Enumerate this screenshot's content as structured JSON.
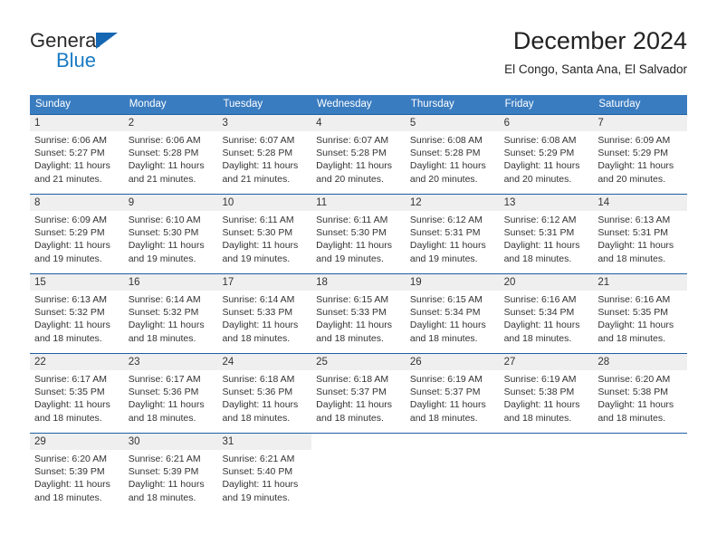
{
  "logo": {
    "word_one": "General",
    "word_two": "Blue",
    "triangle_icon": "blue-triangle-icon",
    "accent_color": "#1a7bc4"
  },
  "header": {
    "title": "December 2024",
    "subtitle": "El Congo, Santa Ana, El Salvador"
  },
  "colors": {
    "header_row": "#3a7cc0",
    "week_divider": "#1e5fa3",
    "day_number_band": "#efefef",
    "text": "#333333"
  },
  "calendar": {
    "weekdays": [
      "Sunday",
      "Monday",
      "Tuesday",
      "Wednesday",
      "Thursday",
      "Friday",
      "Saturday"
    ],
    "weeks": [
      [
        {
          "day": "1",
          "sunrise": "Sunrise: 6:06 AM",
          "sunset": "Sunset: 5:27 PM",
          "daylight_line1": "Daylight: 11 hours",
          "daylight_line2": "and 21 minutes."
        },
        {
          "day": "2",
          "sunrise": "Sunrise: 6:06 AM",
          "sunset": "Sunset: 5:28 PM",
          "daylight_line1": "Daylight: 11 hours",
          "daylight_line2": "and 21 minutes."
        },
        {
          "day": "3",
          "sunrise": "Sunrise: 6:07 AM",
          "sunset": "Sunset: 5:28 PM",
          "daylight_line1": "Daylight: 11 hours",
          "daylight_line2": "and 21 minutes."
        },
        {
          "day": "4",
          "sunrise": "Sunrise: 6:07 AM",
          "sunset": "Sunset: 5:28 PM",
          "daylight_line1": "Daylight: 11 hours",
          "daylight_line2": "and 20 minutes."
        },
        {
          "day": "5",
          "sunrise": "Sunrise: 6:08 AM",
          "sunset": "Sunset: 5:28 PM",
          "daylight_line1": "Daylight: 11 hours",
          "daylight_line2": "and 20 minutes."
        },
        {
          "day": "6",
          "sunrise": "Sunrise: 6:08 AM",
          "sunset": "Sunset: 5:29 PM",
          "daylight_line1": "Daylight: 11 hours",
          "daylight_line2": "and 20 minutes."
        },
        {
          "day": "7",
          "sunrise": "Sunrise: 6:09 AM",
          "sunset": "Sunset: 5:29 PM",
          "daylight_line1": "Daylight: 11 hours",
          "daylight_line2": "and 20 minutes."
        }
      ],
      [
        {
          "day": "8",
          "sunrise": "Sunrise: 6:09 AM",
          "sunset": "Sunset: 5:29 PM",
          "daylight_line1": "Daylight: 11 hours",
          "daylight_line2": "and 19 minutes."
        },
        {
          "day": "9",
          "sunrise": "Sunrise: 6:10 AM",
          "sunset": "Sunset: 5:30 PM",
          "daylight_line1": "Daylight: 11 hours",
          "daylight_line2": "and 19 minutes."
        },
        {
          "day": "10",
          "sunrise": "Sunrise: 6:11 AM",
          "sunset": "Sunset: 5:30 PM",
          "daylight_line1": "Daylight: 11 hours",
          "daylight_line2": "and 19 minutes."
        },
        {
          "day": "11",
          "sunrise": "Sunrise: 6:11 AM",
          "sunset": "Sunset: 5:30 PM",
          "daylight_line1": "Daylight: 11 hours",
          "daylight_line2": "and 19 minutes."
        },
        {
          "day": "12",
          "sunrise": "Sunrise: 6:12 AM",
          "sunset": "Sunset: 5:31 PM",
          "daylight_line1": "Daylight: 11 hours",
          "daylight_line2": "and 19 minutes."
        },
        {
          "day": "13",
          "sunrise": "Sunrise: 6:12 AM",
          "sunset": "Sunset: 5:31 PM",
          "daylight_line1": "Daylight: 11 hours",
          "daylight_line2": "and 18 minutes."
        },
        {
          "day": "14",
          "sunrise": "Sunrise: 6:13 AM",
          "sunset": "Sunset: 5:31 PM",
          "daylight_line1": "Daylight: 11 hours",
          "daylight_line2": "and 18 minutes."
        }
      ],
      [
        {
          "day": "15",
          "sunrise": "Sunrise: 6:13 AM",
          "sunset": "Sunset: 5:32 PM",
          "daylight_line1": "Daylight: 11 hours",
          "daylight_line2": "and 18 minutes."
        },
        {
          "day": "16",
          "sunrise": "Sunrise: 6:14 AM",
          "sunset": "Sunset: 5:32 PM",
          "daylight_line1": "Daylight: 11 hours",
          "daylight_line2": "and 18 minutes."
        },
        {
          "day": "17",
          "sunrise": "Sunrise: 6:14 AM",
          "sunset": "Sunset: 5:33 PM",
          "daylight_line1": "Daylight: 11 hours",
          "daylight_line2": "and 18 minutes."
        },
        {
          "day": "18",
          "sunrise": "Sunrise: 6:15 AM",
          "sunset": "Sunset: 5:33 PM",
          "daylight_line1": "Daylight: 11 hours",
          "daylight_line2": "and 18 minutes."
        },
        {
          "day": "19",
          "sunrise": "Sunrise: 6:15 AM",
          "sunset": "Sunset: 5:34 PM",
          "daylight_line1": "Daylight: 11 hours",
          "daylight_line2": "and 18 minutes."
        },
        {
          "day": "20",
          "sunrise": "Sunrise: 6:16 AM",
          "sunset": "Sunset: 5:34 PM",
          "daylight_line1": "Daylight: 11 hours",
          "daylight_line2": "and 18 minutes."
        },
        {
          "day": "21",
          "sunrise": "Sunrise: 6:16 AM",
          "sunset": "Sunset: 5:35 PM",
          "daylight_line1": "Daylight: 11 hours",
          "daylight_line2": "and 18 minutes."
        }
      ],
      [
        {
          "day": "22",
          "sunrise": "Sunrise: 6:17 AM",
          "sunset": "Sunset: 5:35 PM",
          "daylight_line1": "Daylight: 11 hours",
          "daylight_line2": "and 18 minutes."
        },
        {
          "day": "23",
          "sunrise": "Sunrise: 6:17 AM",
          "sunset": "Sunset: 5:36 PM",
          "daylight_line1": "Daylight: 11 hours",
          "daylight_line2": "and 18 minutes."
        },
        {
          "day": "24",
          "sunrise": "Sunrise: 6:18 AM",
          "sunset": "Sunset: 5:36 PM",
          "daylight_line1": "Daylight: 11 hours",
          "daylight_line2": "and 18 minutes."
        },
        {
          "day": "25",
          "sunrise": "Sunrise: 6:18 AM",
          "sunset": "Sunset: 5:37 PM",
          "daylight_line1": "Daylight: 11 hours",
          "daylight_line2": "and 18 minutes."
        },
        {
          "day": "26",
          "sunrise": "Sunrise: 6:19 AM",
          "sunset": "Sunset: 5:37 PM",
          "daylight_line1": "Daylight: 11 hours",
          "daylight_line2": "and 18 minutes."
        },
        {
          "day": "27",
          "sunrise": "Sunrise: 6:19 AM",
          "sunset": "Sunset: 5:38 PM",
          "daylight_line1": "Daylight: 11 hours",
          "daylight_line2": "and 18 minutes."
        },
        {
          "day": "28",
          "sunrise": "Sunrise: 6:20 AM",
          "sunset": "Sunset: 5:38 PM",
          "daylight_line1": "Daylight: 11 hours",
          "daylight_line2": "and 18 minutes."
        }
      ],
      [
        {
          "day": "29",
          "sunrise": "Sunrise: 6:20 AM",
          "sunset": "Sunset: 5:39 PM",
          "daylight_line1": "Daylight: 11 hours",
          "daylight_line2": "and 18 minutes."
        },
        {
          "day": "30",
          "sunrise": "Sunrise: 6:21 AM",
          "sunset": "Sunset: 5:39 PM",
          "daylight_line1": "Daylight: 11 hours",
          "daylight_line2": "and 18 minutes."
        },
        {
          "day": "31",
          "sunrise": "Sunrise: 6:21 AM",
          "sunset": "Sunset: 5:40 PM",
          "daylight_line1": "Daylight: 11 hours",
          "daylight_line2": "and 19 minutes."
        },
        {
          "day": "",
          "sunrise": "",
          "sunset": "",
          "daylight_line1": "",
          "daylight_line2": ""
        },
        {
          "day": "",
          "sunrise": "",
          "sunset": "",
          "daylight_line1": "",
          "daylight_line2": ""
        },
        {
          "day": "",
          "sunrise": "",
          "sunset": "",
          "daylight_line1": "",
          "daylight_line2": ""
        },
        {
          "day": "",
          "sunrise": "",
          "sunset": "",
          "daylight_line1": "",
          "daylight_line2": ""
        }
      ]
    ]
  }
}
